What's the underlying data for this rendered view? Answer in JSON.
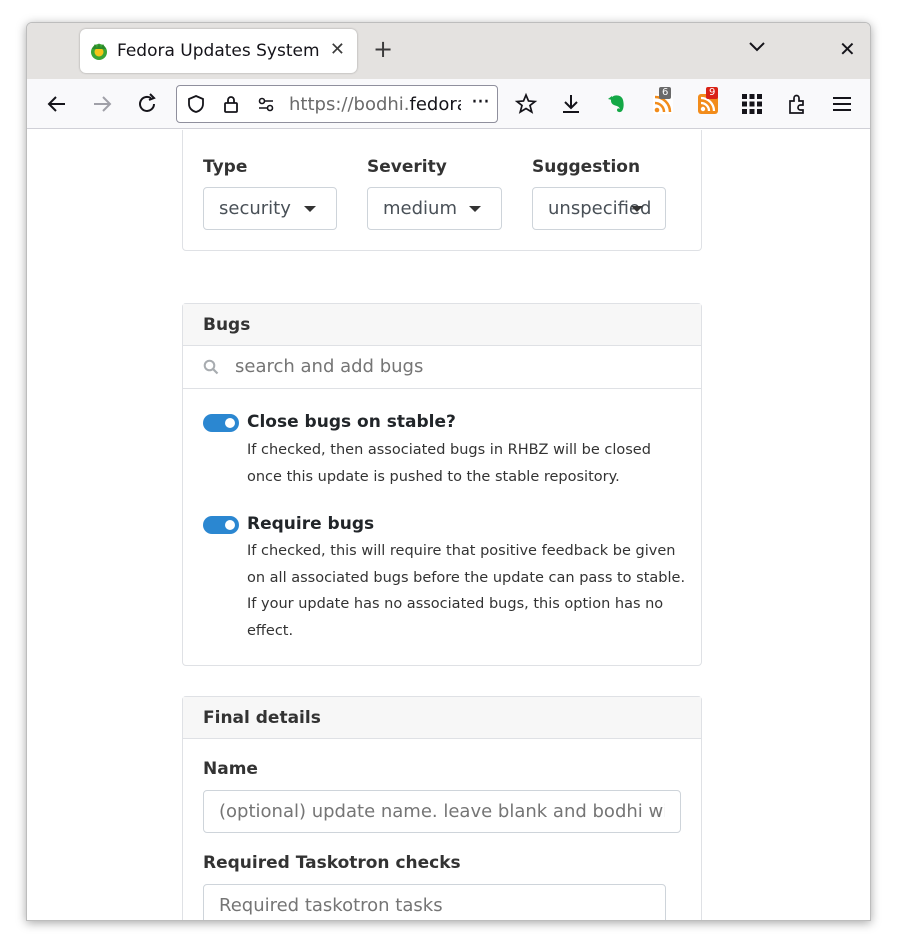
{
  "browser": {
    "tab_title": "Fedora Updates System",
    "url_prefix": "https://bodhi.",
    "url_domain": "fedora",
    "url_more": "···",
    "feed_badge_1": "6",
    "feed_badge_2": "9",
    "colors": {
      "badge_gray": "#6a6a6a",
      "badge_red": "#d92215",
      "evernote": "#14a846",
      "feed_orange": "#f28c1b"
    }
  },
  "details": {
    "type_label": "Type",
    "type_value": "security",
    "severity_label": "Severity",
    "severity_value": "medium",
    "suggestion_label": "Suggestion",
    "suggestion_value": "unspecified"
  },
  "bugs": {
    "header": "Bugs",
    "search_placeholder": "search and add bugs",
    "close_title": "Close bugs on stable?",
    "close_desc": "If checked, then associated bugs in RHBZ will be closed once this update is pushed to the stable repository.",
    "close_checked": true,
    "require_title": "Require bugs",
    "require_desc": "If checked, this will require that positive feedback be given on all associated bugs before the update can pass to stable. If your update has no associated bugs, this option has no effect.",
    "require_checked": true,
    "toggle_color": "#2b87d1"
  },
  "final": {
    "header": "Final details",
    "name_label": "Name",
    "name_placeholder": "(optional) update name. leave blank and bodhi will use",
    "taskotron_label": "Required Taskotron checks",
    "taskotron_placeholder": "Required taskotron tasks"
  }
}
